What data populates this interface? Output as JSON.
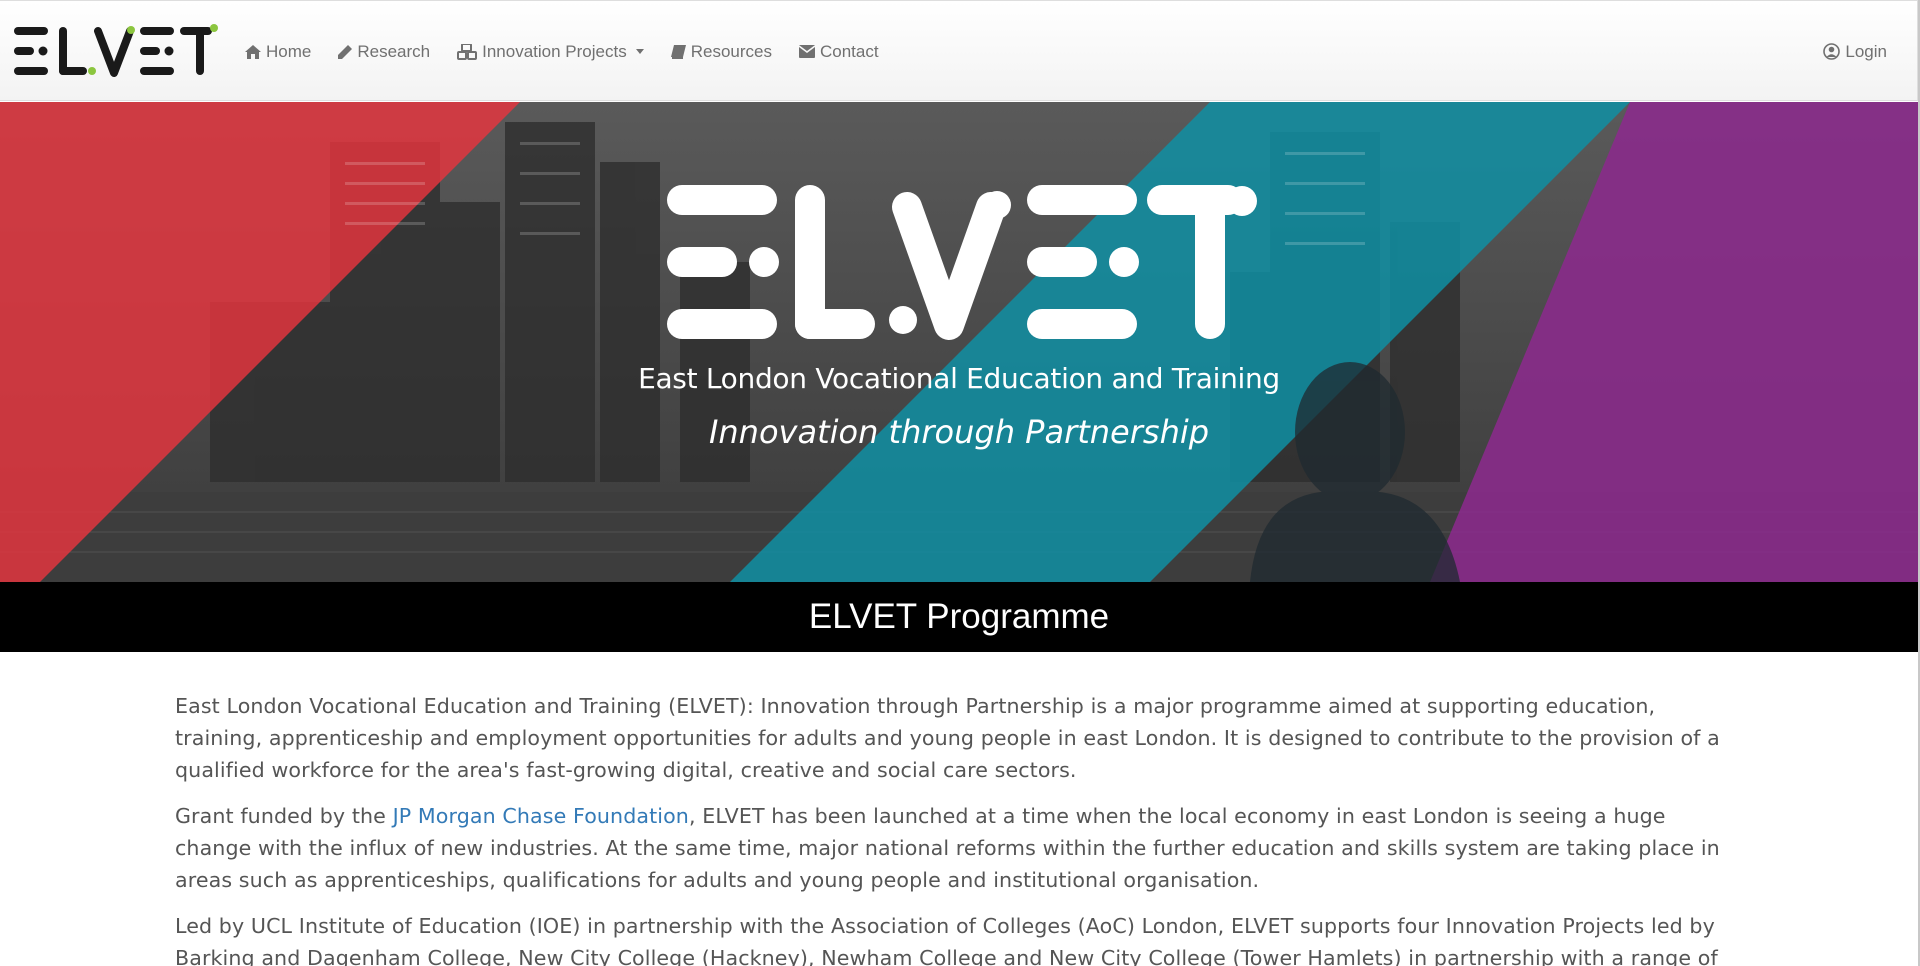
{
  "nav": {
    "brand": "ELVET",
    "items": [
      {
        "label": "Home",
        "icon": "home-icon"
      },
      {
        "label": "Research",
        "icon": "pencil-icon"
      },
      {
        "label": "Innovation Projects",
        "icon": "cubes-icon",
        "dropdown": true
      },
      {
        "label": "Resources",
        "icon": "book-icon"
      },
      {
        "label": "Contact",
        "icon": "envelope-icon"
      }
    ],
    "login": {
      "label": "Login",
      "icon": "user-circle-icon"
    }
  },
  "hero": {
    "logo_text": "ELVET",
    "full_name": "East London Vocational Education and Training",
    "tagline": "Innovation through Partnership"
  },
  "section_title": "ELVET Programme",
  "paragraphs": {
    "p1": "East London Vocational Education and Training (ELVET): Innovation through Partnership is a major programme aimed at supporting education, training, apprenticeship and employment opportunities for adults and young people in east London. It is designed to contribute to the provision of a qualified workforce for the area's fast-growing digital, creative and social care sectors.",
    "p2_before": "Grant funded by the ",
    "p2_link": "JP Morgan Chase Foundation",
    "p2_after": ", ELVET has been launched at a time when the local economy in east London is seeing a huge change with the influx of new industries. At the same time, major national reforms within the further education and skills system are taking place in areas such as apprenticeships, qualifications for adults and young people and institutional organisation.",
    "p3": "Led by UCL Institute of Education (IOE) in partnership with the Association of Colleges (AoC) London, ELVET supports four Innovation Projects led by Barking and Dagenham College, New City College (Hackney), Newham College and New City College (Tower Hamlets) in partnership with a range of"
  },
  "colors": {
    "brand_dark": "#1a1a1a",
    "brand_green": "#8cc63f",
    "hero_red": "#e8343e",
    "hero_teal": "#0f8fa3",
    "hero_purple": "#8b2a8c",
    "link": "#337ab7"
  }
}
